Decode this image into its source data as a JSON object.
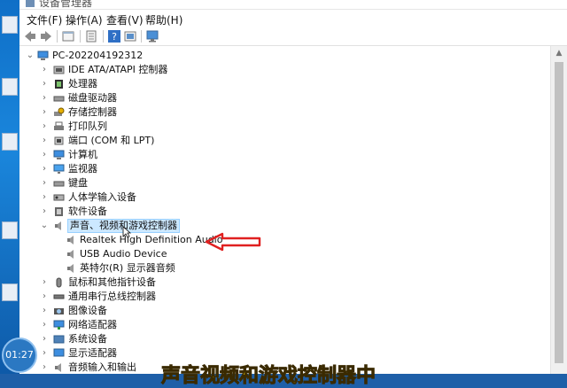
{
  "window": {
    "title": "设备管理器"
  },
  "menu": {
    "file": "文件(F)",
    "action": "操作(A)",
    "view": "查看(V)",
    "help": "帮助(H)"
  },
  "toolbar": {
    "icons": [
      "back-arrow",
      "forward-arrow",
      "properties",
      "show-hide",
      "help",
      "update",
      "monitor"
    ]
  },
  "tree": {
    "root": "PC-202204192312",
    "items": [
      "IDE ATA/ATAPI 控制器",
      "处理器",
      "磁盘驱动器",
      "存储控制器",
      "打印队列",
      "端口 (COM 和 LPT)",
      "计算机",
      "监视器",
      "键盘",
      "人体学输入设备",
      "软件设备",
      "声音、视频和游戏控制器",
      "Realtek High Definition Audio",
      "USB Audio Device",
      "英特尔(R) 显示器音频",
      "鼠标和其他指针设备",
      "通用串行总线控制器",
      "图像设备",
      "网络适配器",
      "系统设备",
      "显示适配器",
      "音频输入和输出"
    ]
  },
  "overlay": {
    "time": "01:27",
    "caption": "声音视频和游戏控制器中"
  },
  "colors": {
    "arrow": "#e02020",
    "selection": "#cce8ff",
    "caption": "#f7d100"
  }
}
